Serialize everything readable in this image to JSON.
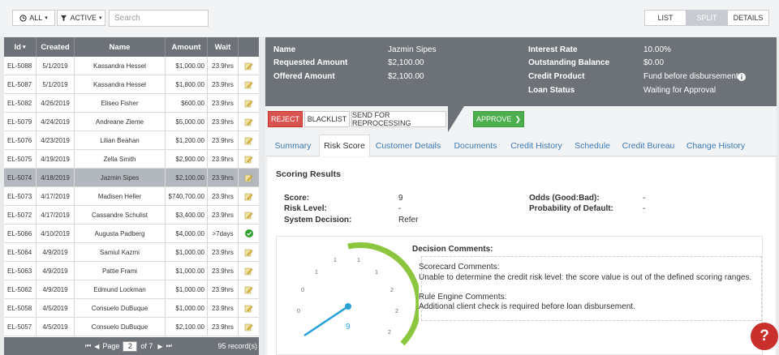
{
  "toolbar": {
    "all_label": "ALL",
    "active_label": "ACTIVE",
    "search_placeholder": "Search",
    "views": [
      "LIST",
      "SPLIT",
      "DETAILS"
    ],
    "active_view": "SPLIT"
  },
  "table": {
    "headers": [
      "Id",
      "Created",
      "Name",
      "Amount",
      "Wait"
    ],
    "rows": [
      {
        "id": "EL-5088",
        "created": "5/1/2019",
        "name": "Kassandra Hessel",
        "amount": "$1,000.00",
        "wait": "23.9hrs",
        "icon": "pencil-icon"
      },
      {
        "id": "EL-5087",
        "created": "5/1/2019",
        "name": "Kassandra Hessel",
        "amount": "$1,800.00",
        "wait": "23.9hrs",
        "icon": "pencil-icon"
      },
      {
        "id": "EL-5082",
        "created": "4/26/2019",
        "name": "Eliseo Fisher",
        "amount": "$600.00",
        "wait": "23.9hrs",
        "icon": "pencil-icon"
      },
      {
        "id": "EL-5079",
        "created": "4/24/2019",
        "name": "Andreane Zieme",
        "amount": "$5,000.00",
        "wait": "23.9hrs",
        "icon": "pencil-icon"
      },
      {
        "id": "EL-5076",
        "created": "4/23/2019",
        "name": "Lilian Beahan",
        "amount": "$1,200.00",
        "wait": "23.9hrs",
        "icon": "pencil-icon"
      },
      {
        "id": "EL-5075",
        "created": "4/19/2019",
        "name": "Zella Smith",
        "amount": "$2,900.00",
        "wait": "23.9hrs",
        "icon": "pencil-icon"
      },
      {
        "id": "EL-5074",
        "created": "4/18/2019",
        "name": "Jazmin Sipes",
        "amount": "$2,100.00",
        "wait": "23.9hrs",
        "icon": "pencil-icon",
        "selected": true
      },
      {
        "id": "EL-5073",
        "created": "4/17/2019",
        "name": "Madisen Heller",
        "amount": "$740,700.00",
        "wait": "23.9hrs",
        "icon": "pencil-icon"
      },
      {
        "id": "EL-5072",
        "created": "4/17/2019",
        "name": "Cassandre Schulist",
        "amount": "$3,400.00",
        "wait": "23.9hrs",
        "icon": "pencil-icon"
      },
      {
        "id": "EL-5066",
        "created": "4/10/2019",
        "name": "Augusta Padberg",
        "amount": "$4,000.00",
        "wait": ">7days",
        "icon": "check-circle-icon"
      },
      {
        "id": "EL-5064",
        "created": "4/9/2019",
        "name": "Samiul Kazmi",
        "amount": "$1,000.00",
        "wait": "23.9hrs",
        "icon": "pencil-icon"
      },
      {
        "id": "EL-5063",
        "created": "4/9/2019",
        "name": "Pattie Frami",
        "amount": "$1,000.00",
        "wait": "23.9hrs",
        "icon": "pencil-icon"
      },
      {
        "id": "EL-5062",
        "created": "4/9/2019",
        "name": "Edmund Lockman",
        "amount": "$1,000.00",
        "wait": "23.9hrs",
        "icon": "pencil-icon"
      },
      {
        "id": "EL-5058",
        "created": "4/5/2019",
        "name": "Consuelo DuBuque",
        "amount": "$1,000.00",
        "wait": "23.9hrs",
        "icon": "pencil-icon"
      },
      {
        "id": "EL-5057",
        "created": "4/5/2019",
        "name": "Consuelo DuBuque",
        "amount": "$2,100.00",
        "wait": "23.9hrs",
        "icon": "pencil-icon"
      }
    ],
    "pager": {
      "page_label": "Page",
      "page": "2",
      "of_label": "of 7",
      "records": "95 record(s)"
    }
  },
  "details": {
    "name_label": "Name",
    "name": "Jazmin Sipes",
    "requested_label": "Requested Amount",
    "requested": "$2,100.00",
    "offered_label": "Offered Amount",
    "offered": "$2,100.00",
    "rate_label": "Interest Rate",
    "rate": "10.00%",
    "outstanding_label": "Outstanding Balance",
    "outstanding": "$0.00",
    "product_label": "Credit Product",
    "product": "Fund before disbursement",
    "status_label": "Loan Status",
    "status": "Waiting for Approval"
  },
  "actions": {
    "reject": "REJECT",
    "blacklist": "BLACKLIST",
    "reprocess": "SEND FOR REPROCESSING",
    "approve": "APPROVE"
  },
  "tabs": [
    "Summary",
    "Risk Score",
    "Customer Details",
    "Documents",
    "Credit History",
    "Schedule",
    "Credit Bureau",
    "Change History"
  ],
  "active_tab": "Risk Score",
  "risk": {
    "title": "Scoring Results",
    "score_label": "Score:",
    "score": "9",
    "level_label": "Risk Level:",
    "level": "-",
    "decision_label": "System Decision:",
    "decision": "Refer",
    "odds_label": "Odds (Good:Bad):",
    "odds": "-",
    "pd_label": "Probability of Default:",
    "pd": "-",
    "gauge_value": "9",
    "gauge_ticks": [
      "0",
      "0",
      "1",
      "1",
      "1",
      "1",
      "2",
      "2",
      "2"
    ],
    "comments_title": "Decision Comments:",
    "scorecard_title": "Scorecard Comments:",
    "scorecard_text": "Unable to determine the credit risk level: the score value is out of the defined scoring ranges.",
    "rule_title": "Rule Engine Comments:",
    "rule_text": "Additional client check is required before loan disbursement."
  },
  "colors": {
    "header": "#6d7278",
    "reject": "#d9534f",
    "approve": "#4cae4c",
    "gauge": "#8cc63f",
    "needle": "#2a9fd6",
    "link": "#3a7ab8"
  }
}
